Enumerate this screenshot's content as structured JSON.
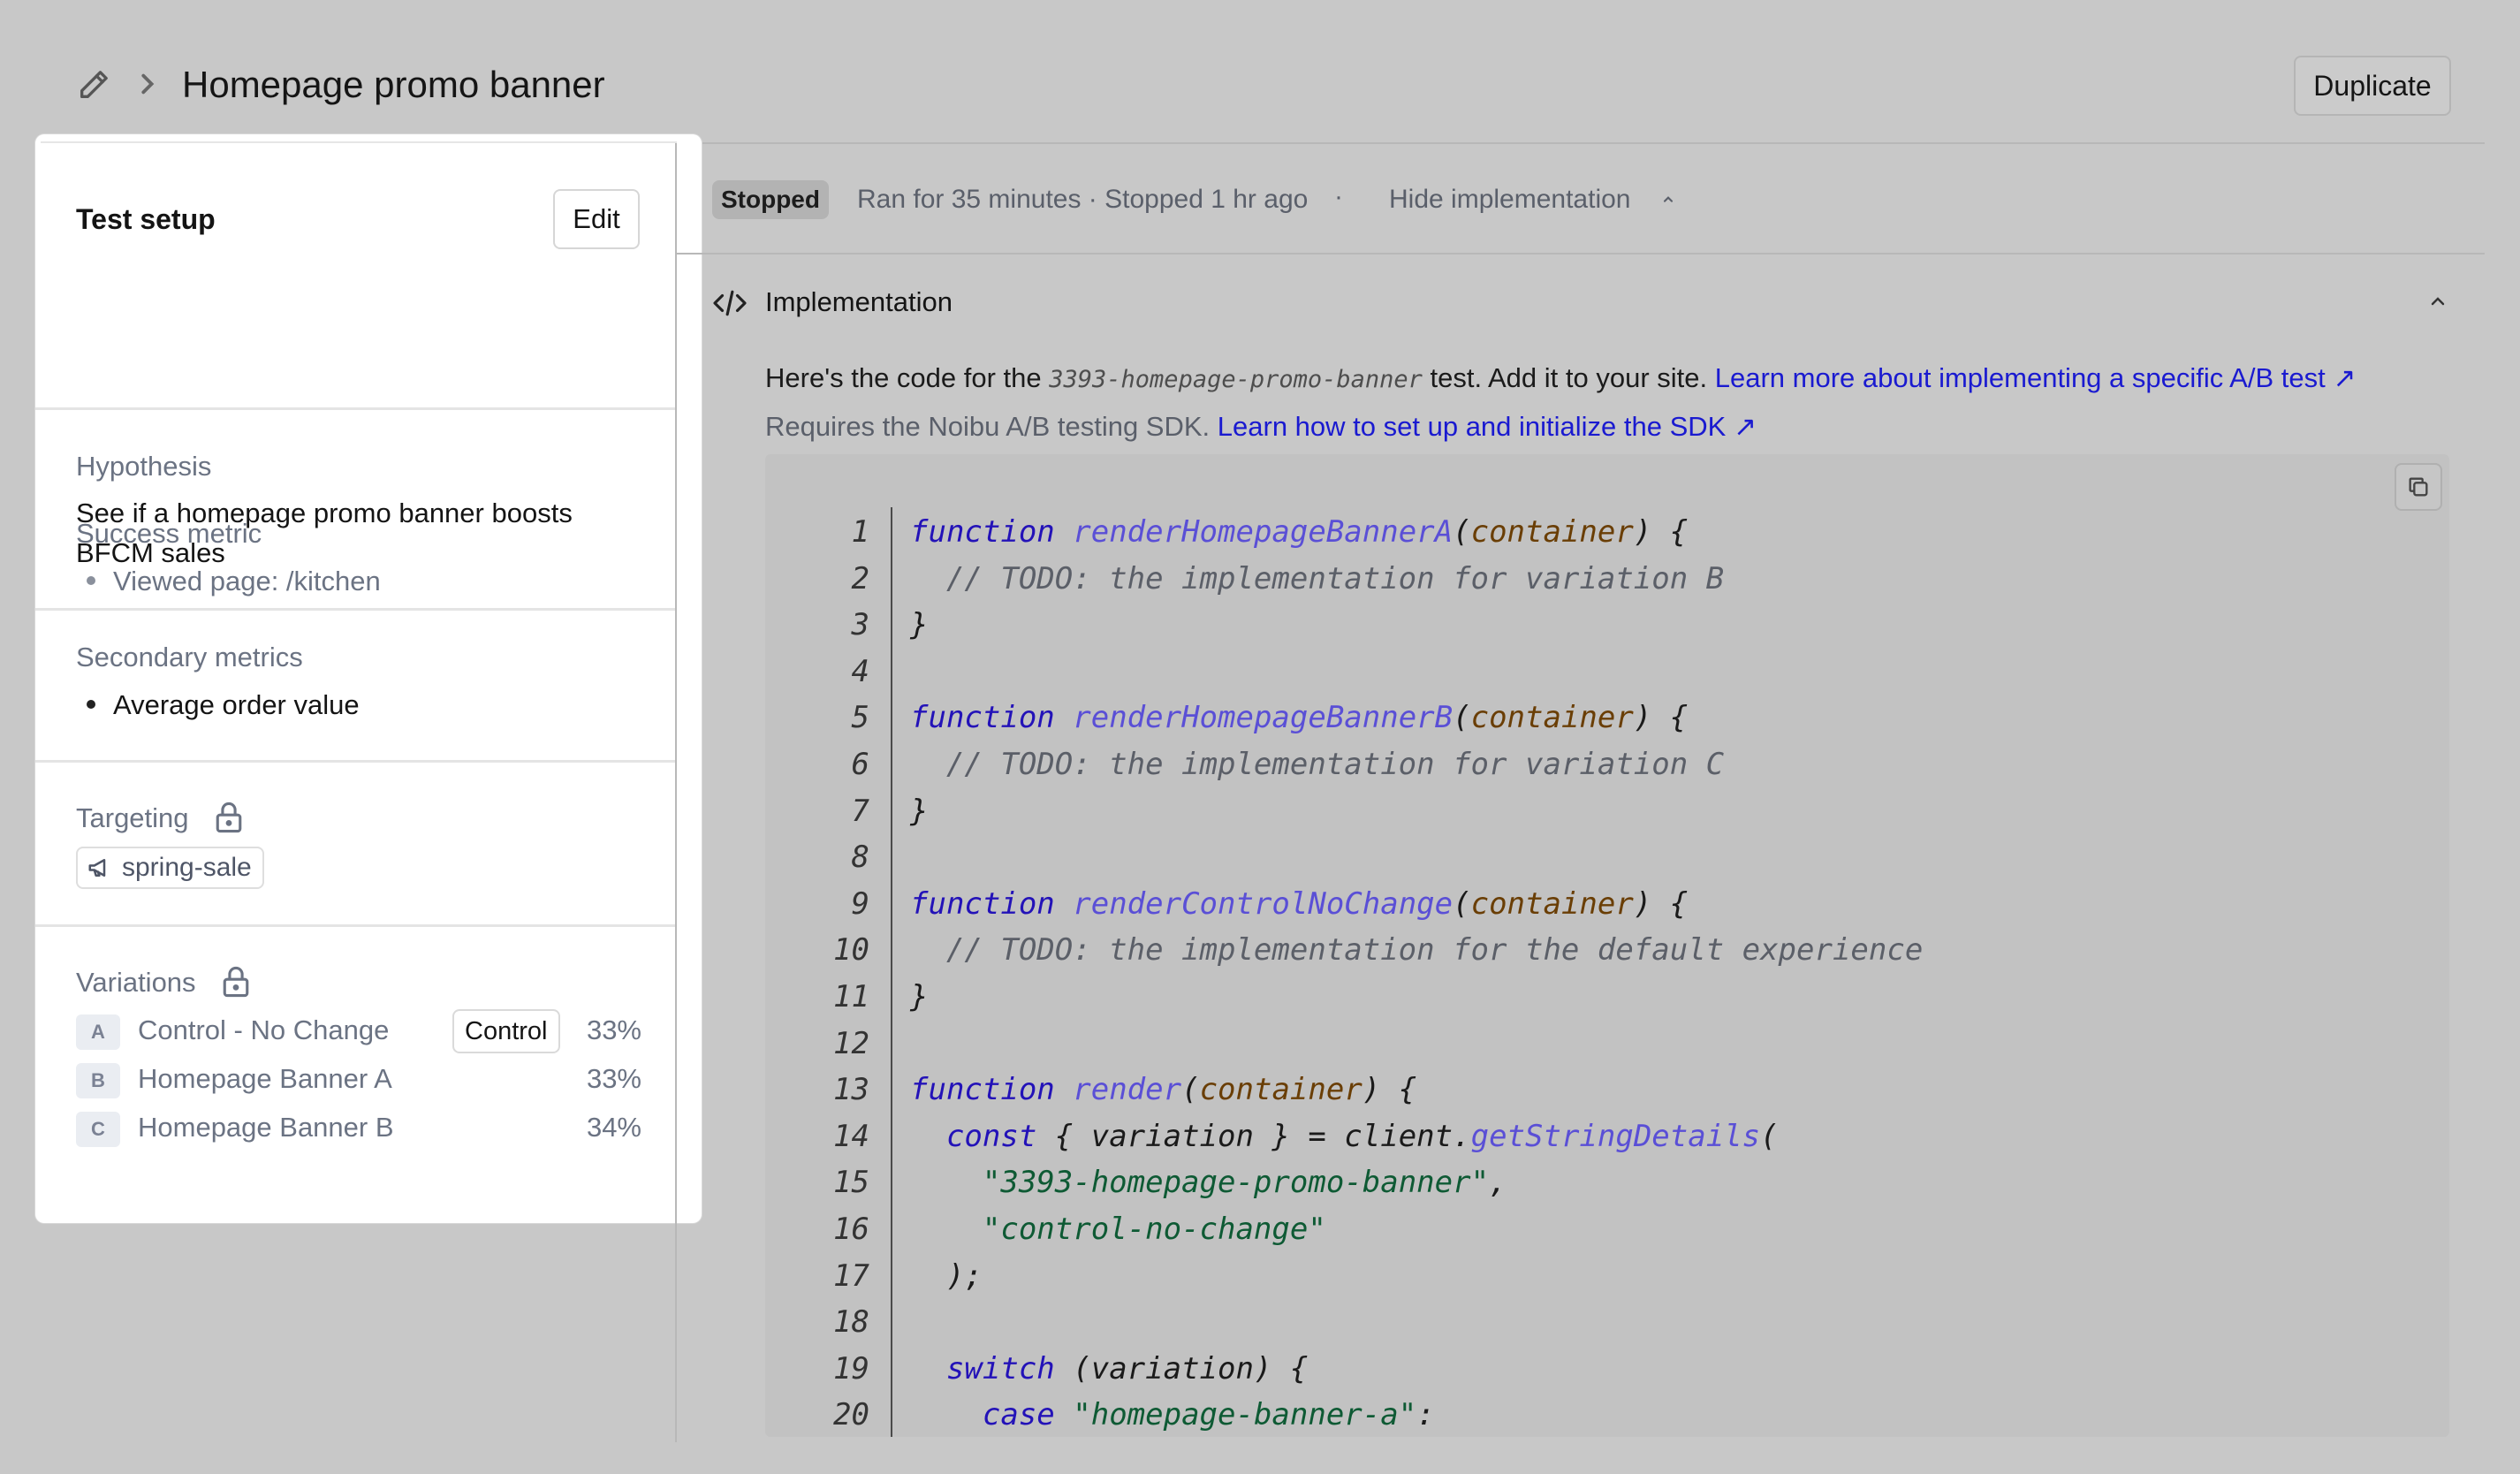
{
  "header": {
    "title": "Homepage promo banner",
    "duplicate_label": "Duplicate"
  },
  "left_panel": {
    "test_setup": {
      "title": "Test setup",
      "edit_label": "Edit"
    },
    "hypothesis": {
      "label": "Hypothesis",
      "text": "See if a homepage promo banner boosts BFCM sales"
    },
    "success_metric": {
      "label": "Success metric",
      "items": [
        "Viewed page: /kitchen"
      ]
    },
    "secondary_metrics": {
      "label": "Secondary metrics",
      "items": [
        "Average order value"
      ]
    },
    "targeting": {
      "label": "Targeting",
      "tag": "spring-sale"
    },
    "variations": {
      "label": "Variations",
      "control_badge": "Control",
      "items": [
        {
          "letter": "A",
          "name": "Control - No Change",
          "percent": "33%"
        },
        {
          "letter": "B",
          "name": "Homepage Banner A",
          "percent": "33%"
        },
        {
          "letter": "C",
          "name": "Homepage Banner B",
          "percent": "34%"
        }
      ]
    }
  },
  "status": {
    "badge": "Stopped",
    "text": "Ran for 35 minutes · Stopped 1 hr ago",
    "separator": "·",
    "hide_label": "Hide implementation"
  },
  "implementation": {
    "title": "Implementation",
    "desc_prefix": "Here's the code for the ",
    "test_key": "3393-homepage-promo-banner",
    "desc_suffix": " test. Add it to your site. ",
    "learn_link": "Learn more about implementing a specific A/B test ↗",
    "sdk_text": "Requires the Noibu A/B testing SDK. ",
    "sdk_link": "Learn how to set up and initialize the SDK ↗"
  },
  "code": {
    "lines": [
      {
        "n": "1",
        "tokens": [
          [
            "kw",
            "function"
          ],
          [
            "t",
            " "
          ],
          [
            "fn",
            "renderHomepageBannerA"
          ],
          [
            "t",
            "("
          ],
          [
            "pm",
            "container"
          ],
          [
            "t",
            ") {"
          ]
        ]
      },
      {
        "n": "2",
        "tokens": [
          [
            "cm",
            "  // TODO: the implementation for variation B"
          ]
        ]
      },
      {
        "n": "3",
        "tokens": [
          [
            "t",
            "}"
          ]
        ]
      },
      {
        "n": "4",
        "tokens": []
      },
      {
        "n": "5",
        "tokens": [
          [
            "kw",
            "function"
          ],
          [
            "t",
            " "
          ],
          [
            "fn",
            "renderHomepageBannerB"
          ],
          [
            "t",
            "("
          ],
          [
            "pm",
            "container"
          ],
          [
            "t",
            ") {"
          ]
        ]
      },
      {
        "n": "6",
        "tokens": [
          [
            "cm",
            "  // TODO: the implementation for variation C"
          ]
        ]
      },
      {
        "n": "7",
        "tokens": [
          [
            "t",
            "}"
          ]
        ]
      },
      {
        "n": "8",
        "tokens": []
      },
      {
        "n": "9",
        "tokens": [
          [
            "kw",
            "function"
          ],
          [
            "t",
            " "
          ],
          [
            "fn",
            "renderControlNoChange"
          ],
          [
            "t",
            "("
          ],
          [
            "pm",
            "container"
          ],
          [
            "t",
            ") {"
          ]
        ]
      },
      {
        "n": "10",
        "tokens": [
          [
            "cm",
            "  // TODO: the implementation for the default experience"
          ]
        ]
      },
      {
        "n": "11",
        "tokens": [
          [
            "t",
            "}"
          ]
        ]
      },
      {
        "n": "12",
        "tokens": []
      },
      {
        "n": "13",
        "tokens": [
          [
            "kw",
            "function"
          ],
          [
            "t",
            " "
          ],
          [
            "fn",
            "render"
          ],
          [
            "t",
            "("
          ],
          [
            "pm",
            "container"
          ],
          [
            "t",
            ") {"
          ]
        ]
      },
      {
        "n": "14",
        "tokens": [
          [
            "t",
            "  "
          ],
          [
            "kw",
            "const"
          ],
          [
            "t",
            " { variation } = client."
          ],
          [
            "fn",
            "getStringDetails"
          ],
          [
            "t",
            "("
          ]
        ]
      },
      {
        "n": "15",
        "tokens": [
          [
            "t",
            "    "
          ],
          [
            "st",
            "\"3393-homepage-promo-banner\""
          ],
          [
            "t",
            ","
          ]
        ]
      },
      {
        "n": "16",
        "tokens": [
          [
            "t",
            "    "
          ],
          [
            "st",
            "\"control-no-change\""
          ]
        ]
      },
      {
        "n": "17",
        "tokens": [
          [
            "t",
            "  );"
          ]
        ]
      },
      {
        "n": "18",
        "tokens": []
      },
      {
        "n": "19",
        "tokens": [
          [
            "t",
            "  "
          ],
          [
            "kw",
            "switch"
          ],
          [
            "t",
            " (variation) {"
          ]
        ]
      },
      {
        "n": "20",
        "tokens": [
          [
            "t",
            "    "
          ],
          [
            "kw",
            "case"
          ],
          [
            "t",
            " "
          ],
          [
            "st",
            "\"homepage-banner-a\""
          ],
          [
            "t",
            ":"
          ]
        ]
      }
    ]
  }
}
